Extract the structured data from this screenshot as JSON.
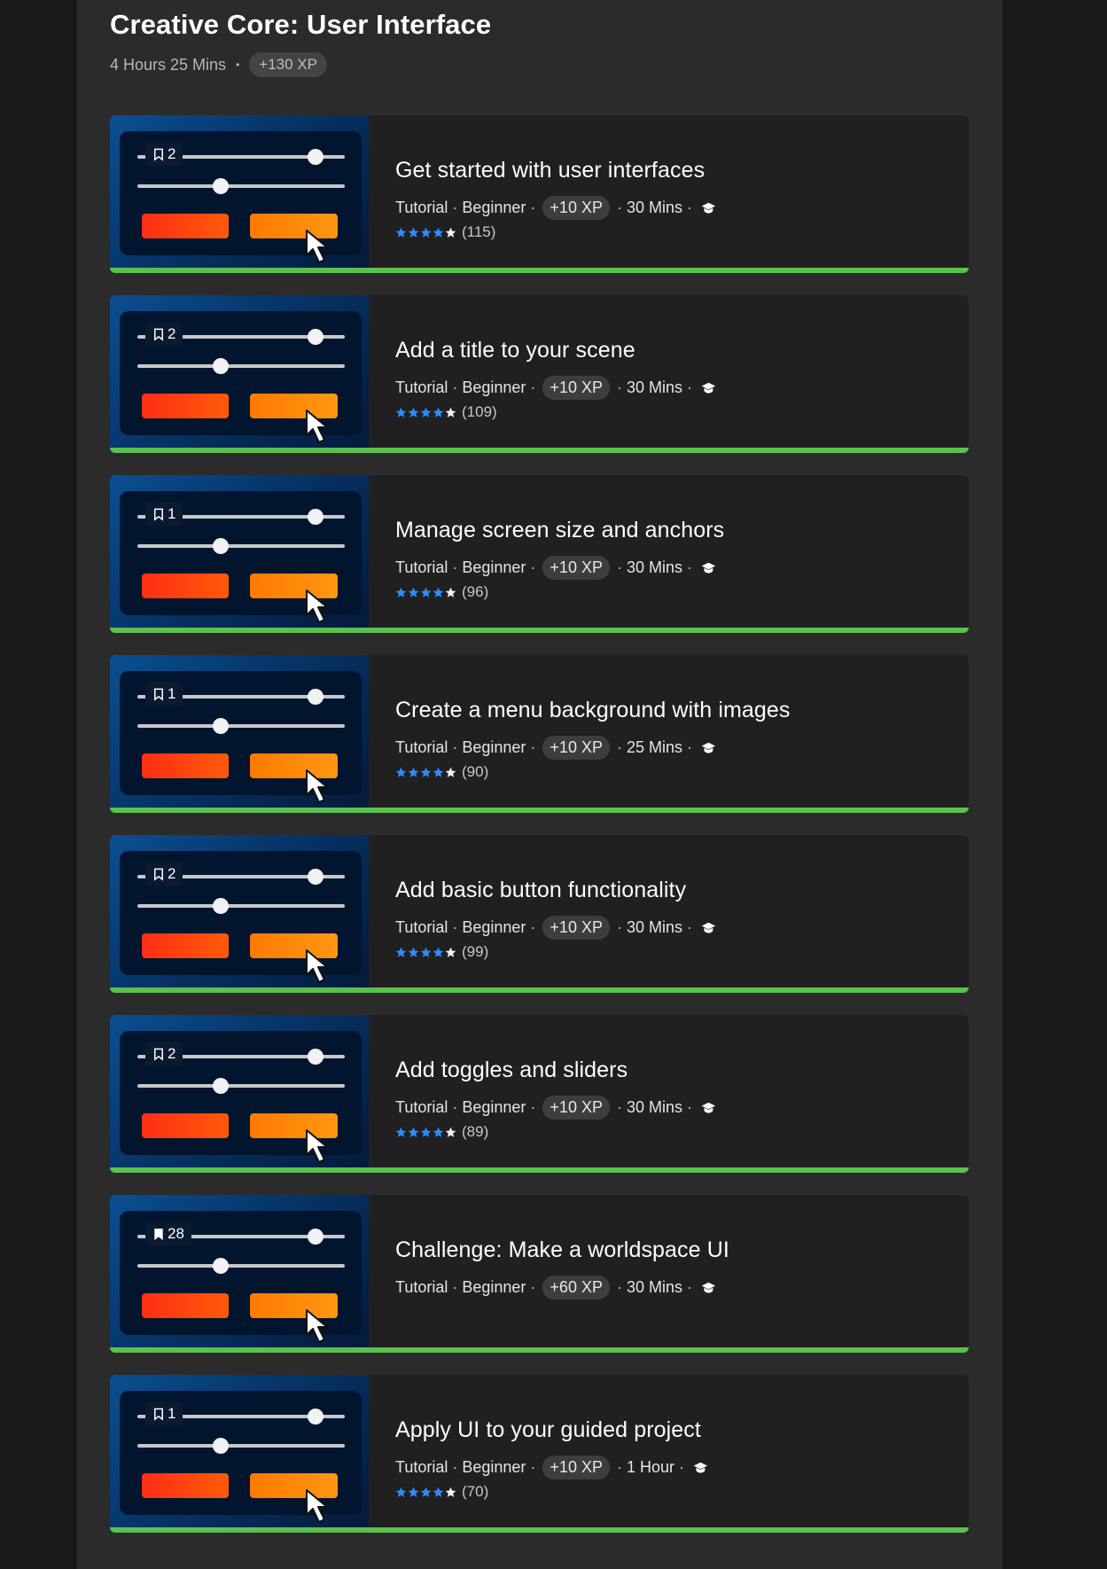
{
  "course": {
    "title": "Creative Core: User Interface",
    "duration": "4 Hours 25 Mins",
    "separator": "•",
    "xp": "+130 XP"
  },
  "colors": {
    "progress": "#5cc050",
    "star_filled": "#2d8cff",
    "star_empty": "#f0f0f0",
    "button_red": "#ff3a12",
    "button_orange": "#ff8a08"
  },
  "lessons": [
    {
      "title": "Get started with user interfaces",
      "type": "Tutorial",
      "level": "Beginner",
      "xp": "+10 XP",
      "duration": "30 Mins",
      "badge": "2",
      "bookmark": "outline",
      "rating_count": "(115)",
      "stars": 4,
      "progress": 1.0
    },
    {
      "title": "Add a title to your scene",
      "type": "Tutorial",
      "level": "Beginner",
      "xp": "+10 XP",
      "duration": "30 Mins",
      "badge": "2",
      "bookmark": "outline",
      "rating_count": "(109)",
      "stars": 4,
      "progress": 1.0
    },
    {
      "title": "Manage screen size and anchors",
      "type": "Tutorial",
      "level": "Beginner",
      "xp": "+10 XP",
      "duration": "30 Mins",
      "badge": "1",
      "bookmark": "outline",
      "rating_count": "(96)",
      "stars": 4,
      "progress": 1.0
    },
    {
      "title": "Create a menu background with images",
      "type": "Tutorial",
      "level": "Beginner",
      "xp": "+10 XP",
      "duration": "25 Mins",
      "badge": "1",
      "bookmark": "outline",
      "rating_count": "(90)",
      "stars": 4,
      "progress": 1.0
    },
    {
      "title": "Add basic button functionality",
      "type": "Tutorial",
      "level": "Beginner",
      "xp": "+10 XP",
      "duration": "30 Mins",
      "badge": "2",
      "bookmark": "outline",
      "rating_count": "(99)",
      "stars": 4,
      "progress": 1.0
    },
    {
      "title": "Add toggles and sliders",
      "type": "Tutorial",
      "level": "Beginner",
      "xp": "+10 XP",
      "duration": "30 Mins",
      "badge": "2",
      "bookmark": "outline",
      "rating_count": "(89)",
      "stars": 4,
      "progress": 1.0
    },
    {
      "title": "Challenge: Make a worldspace UI",
      "type": "Tutorial",
      "level": "Beginner",
      "xp": "+60 XP",
      "duration": "30 Mins",
      "badge": "28",
      "bookmark": "filled",
      "rating_count": "",
      "stars": 0,
      "progress": 1.0
    },
    {
      "title": "Apply UI to your guided project",
      "type": "Tutorial",
      "level": "Beginner",
      "xp": "+10 XP",
      "duration": "1 Hour",
      "badge": "1",
      "bookmark": "outline",
      "rating_count": "(70)",
      "stars": 4,
      "progress": 1.0
    }
  ]
}
